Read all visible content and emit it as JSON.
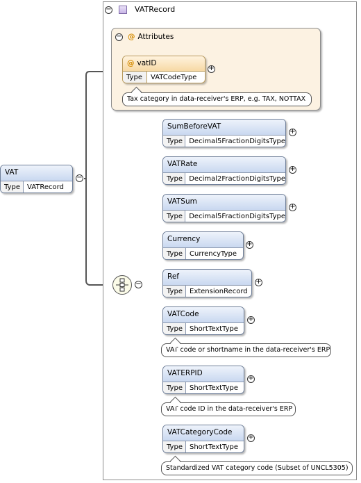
{
  "type_label": "Type",
  "root": {
    "name": "VAT",
    "type": "VATRecord"
  },
  "complex_type": {
    "name": "VATRecord",
    "icon": "complex-type-icon"
  },
  "attributes": {
    "title": "Attributes",
    "items": [
      {
        "name": "vatID",
        "type": "VATCodeType",
        "annotation": "Tax category in data-receiver's ERP, e.g. TAX, NOTTAX"
      }
    ]
  },
  "sequence": {
    "icon": "sequence-compositor-icon"
  },
  "elements": [
    {
      "name": "SumBeforeVAT",
      "type": "Decimal5FractionDigitsType"
    },
    {
      "name": "VATRate",
      "type": "Decimal2FractionDigitsType"
    },
    {
      "name": "VATSum",
      "type": "Decimal5FractionDigitsType"
    },
    {
      "name": "Currency",
      "type": "CurrencyType"
    },
    {
      "name": "Ref",
      "type": "ExtensionRecord"
    },
    {
      "name": "VATCode",
      "type": "ShortTextType",
      "annotation": "VAT code or shortname in the data-receiver's ERP"
    },
    {
      "name": "VATERPID",
      "type": "ShortTextType",
      "annotation": "VAT code ID in the data-receiver's ERP"
    },
    {
      "name": "VATCategoryCode",
      "type": "ShortTextType",
      "annotation": "Standardized VAT category code (Subset of UNCL5305)"
    }
  ],
  "buttons": {
    "expand": "+",
    "collapse": "−"
  },
  "colors": {
    "element_header": "#c9d8f0",
    "attribute_header": "#f7d9a5",
    "attribute_box": "#fcf2e2"
  }
}
